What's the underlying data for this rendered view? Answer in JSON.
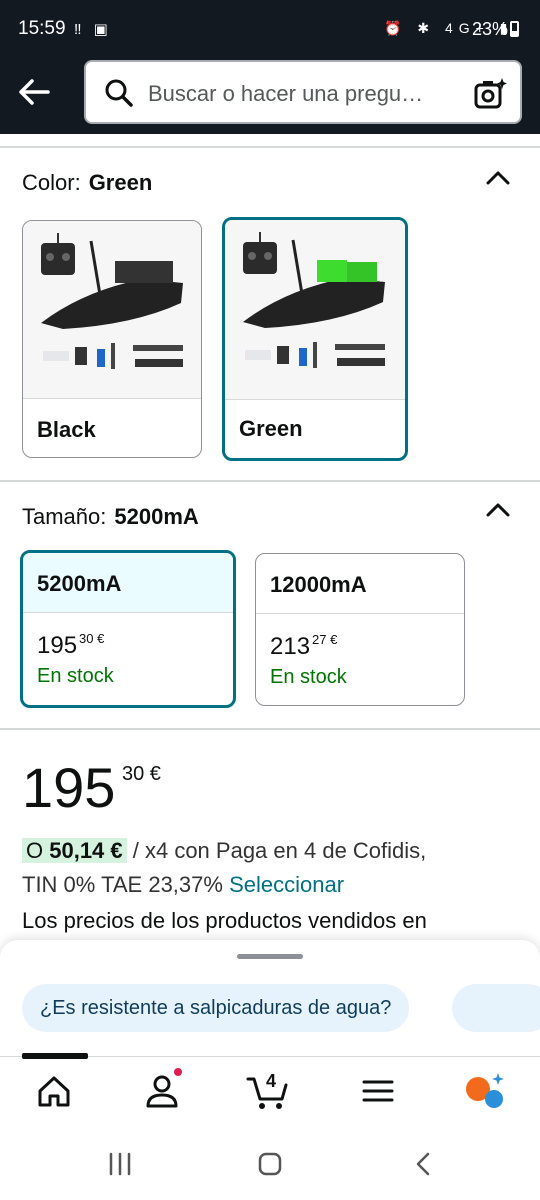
{
  "status": {
    "time": "15:59",
    "left_icons": "‼ ▣",
    "right_icons": "⏰ ✱ 4G+ ▮",
    "battery": "23%"
  },
  "search": {
    "placeholder": "Buscar o hacer una pregu…"
  },
  "color": {
    "label": "Color:",
    "selected": "Green",
    "options": [
      {
        "name": "Black"
      },
      {
        "name": "Green"
      }
    ]
  },
  "size": {
    "label": "Tamaño:",
    "selected": "5200mA",
    "options": [
      {
        "name": "5200mA",
        "price_int": "195",
        "price_cents": "30 €",
        "stock": "En stock"
      },
      {
        "name": "12000mA",
        "price_int": "213",
        "price_cents": "27 €",
        "stock": "En stock"
      }
    ]
  },
  "price": {
    "integer": "195",
    "cents": "30 €",
    "finance_prefix": "O ",
    "finance_amount": "50,14 €",
    "finance_text": " / x4 con Paga en 4 de Cofidis,",
    "finance_line2": "TIN 0% TAE 23,37% ",
    "finance_link": "Seleccionar",
    "cut_text": "Los precios de los productos vendidos en"
  },
  "sheet": {
    "chip": "¿Es resistente a salpicaduras de agua?"
  },
  "tabbar": {
    "cart_count": "4"
  },
  "colors": {
    "header_bg": "#131921",
    "accent": "#007185",
    "stock": "#007600",
    "chip_bg": "#e6f3fc",
    "finance_highlight": "#d5f2df"
  }
}
